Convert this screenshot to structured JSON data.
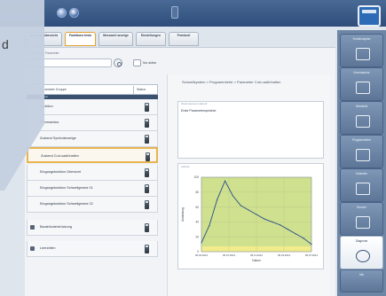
{
  "window": {
    "corner_button_icon": "app-window-icon"
  },
  "tabs": [
    {
      "label": "Meldungs übersicht"
    },
    {
      "label": "Funktions tests"
    },
    {
      "label": "Messwert anzeige"
    },
    {
      "label": "Einstellungen"
    },
    {
      "label": "Protokoll"
    }
  ],
  "search": {
    "label": "Suche nach Parameter",
    "placeholder": "",
    "checkbox_label": "Nur aktive"
  },
  "list": {
    "header_name": "Parameter Gruppe",
    "header_status": "Status",
    "subheader": "Kanal",
    "rows": [
      {
        "label": "Funktion"
      },
      {
        "label": "Kommandos"
      },
      {
        "label": "Zustand Symbolanzeige"
      },
      {
        "label": "Zustand CurLoadInhalten"
      },
      {
        "label": "Eingangsfunktion Übersicht"
      },
      {
        "label": "Eingangsfunktion Schwellgesetz 01"
      },
      {
        "label": "Eingangsfunktion Schwellgesetz 02"
      },
      {
        "label": "Bauteilunterdrückung"
      },
      {
        "label": "Leerzeilen"
      }
    ]
  },
  "detail": {
    "path": "Schwellsystem > Programmierte > Parameter CurLoadInhalten",
    "info_title": "Parameterwert aktuell",
    "info_text": "Erste Parameterspeicher",
    "chart_title": "Verlauf"
  },
  "chart_data": {
    "type": "line",
    "title": "",
    "xlabel": "Datum",
    "ylabel": "Auslastung",
    "x": [
      0,
      1,
      2,
      3,
      4,
      5,
      6,
      7,
      8,
      9,
      10,
      11,
      12,
      13,
      14
    ],
    "y": [
      12,
      35,
      70,
      95,
      75,
      62,
      56,
      50,
      44,
      40,
      36,
      30,
      24,
      18,
      10
    ],
    "ylim": [
      0,
      100
    ],
    "xtick_labels": [
      "05.03.2013",
      "05.07.2013",
      "05.11.2013",
      "05.03.2014",
      "05.07.2014"
    ],
    "ytick_labels": [
      "0",
      "20",
      "40",
      "60",
      "80",
      "100"
    ],
    "background_color": "#cfe08f",
    "line_color": "#2a4f8a"
  },
  "toolbar": [
    {
      "label": "Funktionsplan",
      "icon": "arrow-right-icon"
    },
    {
      "label": "Kommandos",
      "icon": "panel-icon"
    },
    {
      "label": "Übersicht",
      "icon": "save-icon"
    },
    {
      "label": "Programmierer",
      "icon": "wrench-icon"
    },
    {
      "label": "Kalender",
      "icon": "calendar-icon"
    },
    {
      "label": "Service",
      "icon": "tools-icon"
    },
    {
      "label": "Diagnose",
      "icon": "eye-icon"
    },
    {
      "label": "Info",
      "icon": "info-icon"
    }
  ],
  "overlay": {
    "text": "d"
  }
}
